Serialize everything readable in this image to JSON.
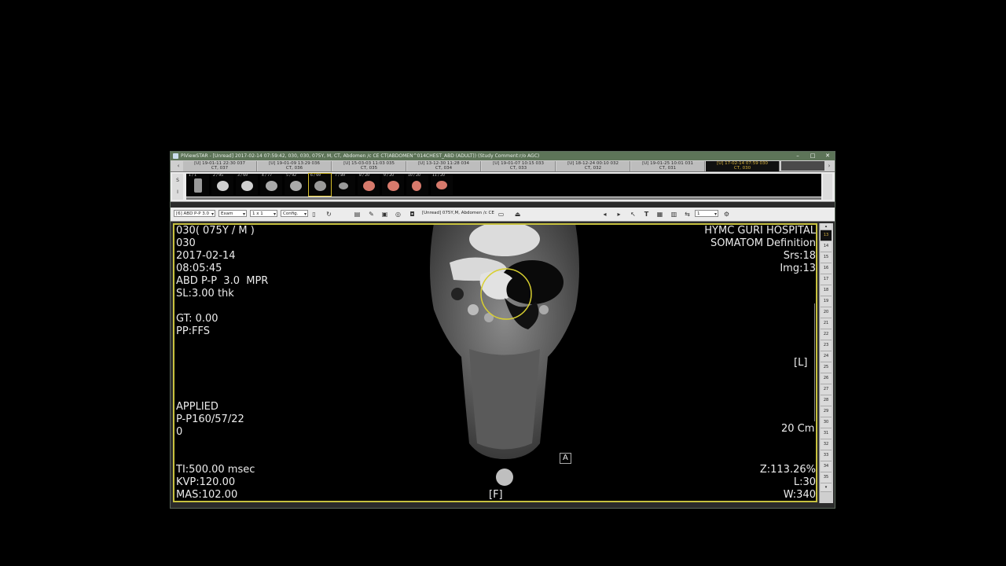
{
  "window": {
    "title": "PiViewSTAR - [Unread] 2017-02-14 07:59:42, 030, 030, 075Y, M, CT, Abdomen /c CE CT(ABDOMEN^014CHEST_ABD (ADULT)) (Study Comment:r/o AGC)",
    "minimize": "–",
    "maximize": "□",
    "close": "✕"
  },
  "study_tabs": [
    {
      "line1": "[U] 19-01-11 22:30  037",
      "line2": "CT, 037"
    },
    {
      "line1": "[U] 19-01-09 13:29  036",
      "line2": "CT, 036"
    },
    {
      "line1": "[U] 15-03-03 11:03  035",
      "line2": "CT, 035"
    },
    {
      "line1": "[U] 13-12-30 11:28  034",
      "line2": "CT, 034"
    },
    {
      "line1": "[U] 19-01-07 10:15  033",
      "line2": "CT, 033"
    },
    {
      "line1": "[U] 18-12-24 00:10  032",
      "line2": "CT, 032"
    },
    {
      "line1": "[U] 19-01-25 10:01  031",
      "line2": "CT, 031"
    },
    {
      "line1": "[U] 17-02-14 07:59  030",
      "line2": "CT, 030"
    }
  ],
  "thumbnails": {
    "side_labels": [
      "S",
      "I"
    ],
    "items": [
      {
        "label": "1 / 1",
        "color": false
      },
      {
        "label": "2 / 95",
        "color": false
      },
      {
        "label": "3 / 69",
        "color": false
      },
      {
        "label": "4 / 77",
        "color": false
      },
      {
        "label": "5 / 92",
        "color": false
      },
      {
        "label": "6 / 69",
        "color": false
      },
      {
        "label": "7 / 89",
        "color": false
      },
      {
        "label": "8 / 20",
        "color": true
      },
      {
        "label": "9 / 20",
        "color": true
      },
      {
        "label": "10 / 20",
        "color": true
      },
      {
        "label": "11 / 20",
        "color": true
      }
    ]
  },
  "toolbar": {
    "series_select": "[6] ABD P-P 3.0",
    "exam_select": "Exam",
    "layout_select": "1 x 1",
    "config_select": "Config.",
    "study_info": "[Unread] 075Y,M, Abdomen /c CE",
    "frame_value": "1"
  },
  "overlay": {
    "top_left": [
      "030( 075Y / M )",
      "030",
      "2017-02-14",
      "08:05:45",
      "ABD P-P  3.0  MPR",
      "SL:3.00 thk",
      "",
      "GT: 0.00",
      "PP:FFS"
    ],
    "mid_left": [
      "APPLIED",
      "P-P160/57/22",
      "0"
    ],
    "bottom_left": [
      "TI:500.00 msec",
      "KVP:120.00",
      "MAS:102.00"
    ],
    "top_right": [
      "HYMC GURI HOSPITAL",
      "SOMATOM Definition",
      "Srs:18",
      "Img:13"
    ],
    "orientation_right": "[L]",
    "scale": "20 Cm",
    "bottom_right": [
      "Z:113.26%",
      "L:30",
      "W:340"
    ],
    "orientation_bottom": "[F]",
    "marker": "A"
  },
  "slice_numbers": [
    "13",
    "14",
    "15",
    "16",
    "17",
    "18",
    "19",
    "20",
    "21",
    "22",
    "23",
    "24",
    "25",
    "26",
    "27",
    "28",
    "29",
    "30",
    "31",
    "32",
    "33",
    "34",
    "35"
  ],
  "current_slice": "13"
}
